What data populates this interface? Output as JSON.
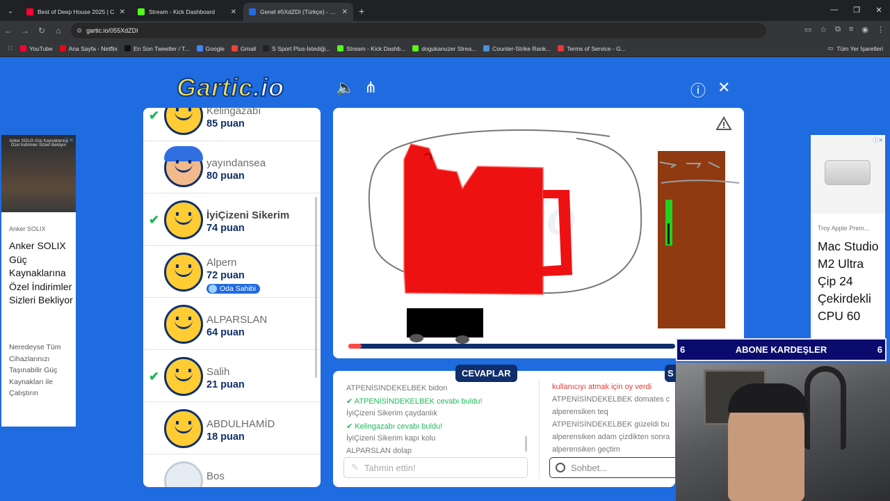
{
  "browser": {
    "tabs": [
      {
        "label": "Best of Deep House 2025 | C",
        "favicon_color": "#ff0033",
        "active": false
      },
      {
        "label": "Stream - Kick Dashboard",
        "favicon_color": "#53fc18",
        "active": false
      },
      {
        "label": "Genel #5XdZDI (Türkçe) - Gartic",
        "favicon_color": "#1f6be0",
        "active": true
      }
    ],
    "url": "gartic.io/055XdZDI",
    "bookmarks": [
      {
        "label": "YouTube",
        "color": "#ff0033"
      },
      {
        "label": "Ana Sayfa - Netflix",
        "color": "#e50914"
      },
      {
        "label": "En Son Tweetler / T...",
        "color": "#111111"
      },
      {
        "label": "Google",
        "color": "#4285f4"
      },
      {
        "label": "Gmail",
        "color": "#ea4335"
      },
      {
        "label": "S Sport Plus-İstediği...",
        "color": "#222222"
      },
      {
        "label": "Stream - Kick Dashb...",
        "color": "#53fc18"
      },
      {
        "label": "dogukanuzer Strea...",
        "color": "#53fc18"
      },
      {
        "label": "Counter-Strike Rank...",
        "color": "#4a90d9"
      },
      {
        "label": "Terms of Service - G...",
        "color": "#e53935"
      }
    ],
    "bookmarks_right": "Tüm Yer İşaretleri"
  },
  "game": {
    "logo_main": "Gartic",
    "logo_suffix": ".io",
    "players": [
      {
        "name": "Kelingazabı",
        "score": "85 puan",
        "guessed": true,
        "avatar": "yellow"
      },
      {
        "name": "yayındansea",
        "score": "80 puan",
        "guessed": false,
        "avatar": "blue"
      },
      {
        "name": "İyiÇizeni Sikerim",
        "score": "74 puan",
        "guessed": true,
        "avatar": "yellow",
        "bold": true
      },
      {
        "name": "Alpern",
        "score": "72 puan",
        "guessed": false,
        "avatar": "yellow",
        "badge": "Oda Sahibi"
      },
      {
        "name": "ALPARSLAN",
        "score": "64 puan",
        "guessed": false,
        "avatar": "yellow"
      },
      {
        "name": "Salih",
        "score": "21 puan",
        "guessed": true,
        "avatar": "yellow"
      },
      {
        "name": "ABDULHAMİD",
        "score": "18 puan",
        "guessed": false,
        "avatar": "yellow"
      },
      {
        "name": "Bos",
        "score": "",
        "guessed": false,
        "avatar": "grey"
      }
    ],
    "timer_progress": 0.04,
    "tabs": {
      "answers": "CEVAPLAR",
      "chat": "S"
    },
    "answers": [
      {
        "user": "ATPENİSİNDEKELBEK",
        "text": "bidon",
        "ok": false
      },
      {
        "user": "ATPENİSİNDEKELBEK",
        "text": "cevabı buldu!",
        "ok": true
      },
      {
        "user": "İyiÇizeni Sikerim",
        "text": "çaydanlık",
        "ok": false
      },
      {
        "user": "Kelingazabı",
        "text": "cevabı buldu!",
        "ok": true
      },
      {
        "user": "İyiÇizeni Sikerim",
        "text": "kapı kolu",
        "ok": false
      },
      {
        "user": "ALPARSLAN",
        "text": "dolap",
        "ok": false
      }
    ],
    "chat": [
      {
        "user": "",
        "text": "kullanıcıyı atmak için oy verdi",
        "red": true
      },
      {
        "user": "ATPENİSİNDEKELBEK",
        "text": "domates c",
        "red": false
      },
      {
        "user": "alperensiken",
        "text": "teq",
        "red": false
      },
      {
        "user": "ATPENİSİNDEKELBEK",
        "text": "güzeldi bu",
        "red": false
      },
      {
        "user": "alperensiken",
        "text": "adam çizdikten sonra",
        "red": false
      },
      {
        "user": "alperensiken",
        "text": "geçtim",
        "red": false
      }
    ],
    "guess_placeholder": "Tahmin ettin!",
    "chat_placeholder": "Sohbet..."
  },
  "ads": {
    "left": {
      "image_text": "Anker SOLIX Güç Kaynaklarına Özel İndirimler Sizleri Bekliyor",
      "brand": "Anker SOLIX",
      "headline": "Anker SOLIX Güç Kaynaklarına Özel İndirimler Sizleri Bekliyor",
      "description": "Neredeyse Tüm Cihazlarınızı Taşınabilir Güç Kaynakları ile Çalıştırın"
    },
    "right": {
      "brand": "Troy Apple Prem...",
      "headline": "Mac Studio M2 Ultra Çip 24 Çekirdekli CPU 60"
    }
  },
  "stream": {
    "banner_left": "6",
    "banner_text": "ABONE KARDEŞLER",
    "banner_right": "6"
  }
}
